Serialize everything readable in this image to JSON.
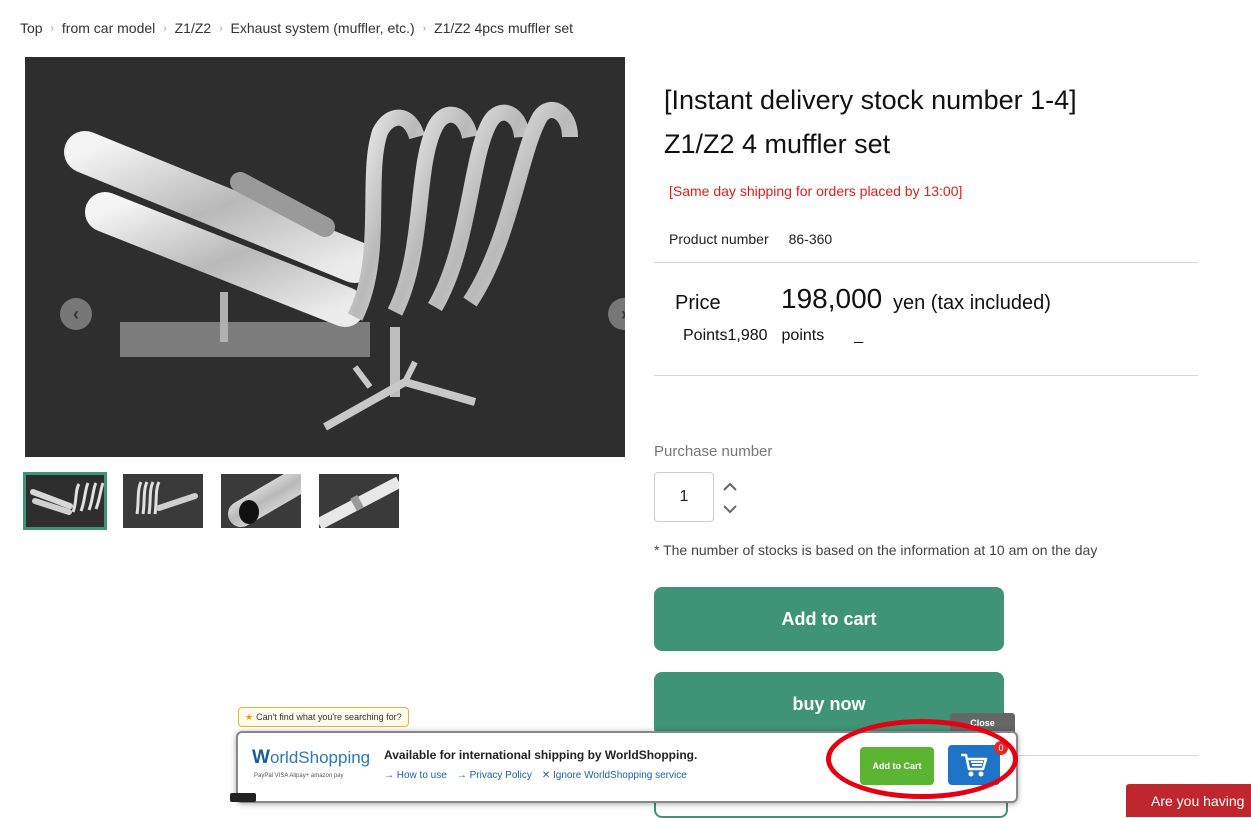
{
  "breadcrumb": [
    "Top",
    "from car model",
    "Z1/Z2",
    "Exhaust system (muffler, etc.)",
    "Z1/Z2 4pcs muffler set"
  ],
  "gallery": {
    "prev_icon": "chevron-left-icon",
    "next_icon": "chevron-right-icon",
    "thumbnail_count": 4,
    "active_thumbnail": 1
  },
  "product": {
    "title_line1": "[Instant delivery stock number 1-4]",
    "title_line2": "Z1/Z2 4 muffler set",
    "same_day_shipping": "[Same day shipping for orders placed by 13:00]",
    "product_number_label": "Product number",
    "product_number": "86-360",
    "price_label": "Price",
    "price_value": "198,000",
    "price_unit": "yen (tax included)",
    "points_label": "Points",
    "points_value": "1,980",
    "points_unit": "points",
    "points_dash": "_"
  },
  "purchase": {
    "label": "Purchase number",
    "quantity": "1",
    "stock_note": "* The number of stocks is based on the information at 10 am on the day",
    "add_to_cart": "Add to cart",
    "buy_now": "buy now"
  },
  "worldshopping": {
    "hint": "Can't find what you're searching for?",
    "close": "Close",
    "logo_w": "W",
    "logo_rest": "orldShopping",
    "payment_methods": "PayPal  VISA  Alipay+  amazon pay",
    "available_text": "Available for international shipping by WorldShopping.",
    "links": [
      "→ How to use",
      "→ Privacy Policy",
      "✕ Ignore WorldShopping service"
    ],
    "add_to_cart": "Add to Cart",
    "cart_count": "0"
  },
  "help_button": "Are you having",
  "colors": {
    "accent_green": "#3f9478",
    "alert_red": "#e01b1b",
    "annotation_red": "#e60012",
    "ws_green": "#5bb432",
    "ws_blue": "#1d74c8"
  }
}
